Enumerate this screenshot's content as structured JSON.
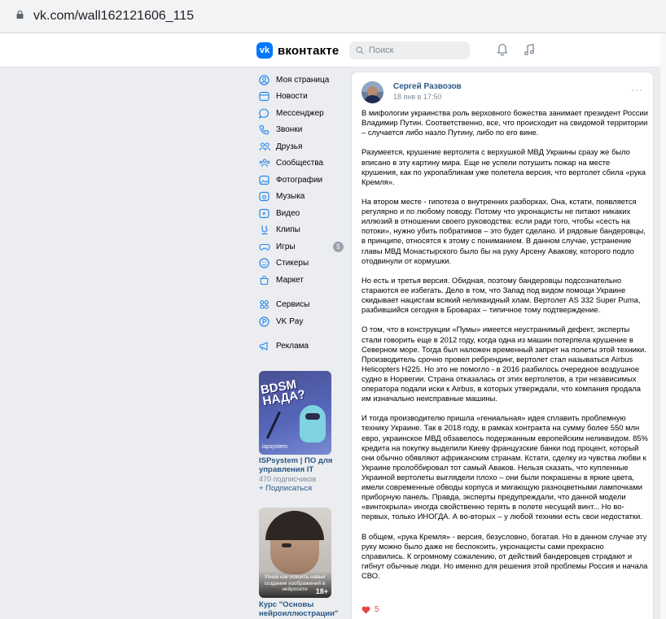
{
  "browser": {
    "url": "vk.com/wall162121606_115"
  },
  "header": {
    "logo_mark": "vk",
    "logo_text": "вконтакте",
    "search_placeholder": "Поиск"
  },
  "sidebar": {
    "items": [
      {
        "label": "Моя страница",
        "icon": "profile-icon"
      },
      {
        "label": "Новости",
        "icon": "news-icon"
      },
      {
        "label": "Мессенджер",
        "icon": "messenger-icon"
      },
      {
        "label": "Звонки",
        "icon": "phone-icon"
      },
      {
        "label": "Друзья",
        "icon": "friends-icon"
      },
      {
        "label": "Сообщества",
        "icon": "communities-icon"
      },
      {
        "label": "Фотографии",
        "icon": "photos-icon"
      },
      {
        "label": "Музыка",
        "icon": "music-icon"
      },
      {
        "label": "Видео",
        "icon": "video-icon"
      },
      {
        "label": "Клипы",
        "icon": "clips-icon"
      },
      {
        "label": "Игры",
        "icon": "games-icon",
        "badge": "5"
      },
      {
        "label": "Стикеры",
        "icon": "stickers-icon"
      },
      {
        "label": "Маркет",
        "icon": "market-icon"
      }
    ],
    "items2": [
      {
        "label": "Сервисы",
        "icon": "services-icon"
      },
      {
        "label": "VK Pay",
        "icon": "vkpay-icon"
      }
    ],
    "ads_label": "Реклама"
  },
  "ads": [
    {
      "image_text": "BDSM НАДА?",
      "brand": "ispsystem",
      "title": "ISPsystem | ПО для управления IT",
      "subscribers": "470 подписчиков",
      "action": "+ Подписаться"
    },
    {
      "image_text": "Узнай как освоить навык создания изображений в нейросети",
      "age": "18+",
      "title": "Курс \"Основы нейроиллюстрации\""
    }
  ],
  "post": {
    "author": "Сергей Развозов",
    "date": "18 янв в 17:50",
    "more": "···",
    "paragraphs": [
      "В мифологии украинства роль верховного божества занимает президент России Владимир Путин. Соответственно, все, что происходит на свидомой территории – случается либо назло Путину, либо по его вине.",
      "Разумеется, крушение вертолета с верхушкой МВД Украины сразу же было вписано в эту картину мира. Еще не успели потушить пожар на месте крушения, как по укропабликам уже полетела версия, что вертолет сбила «рука Кремля».",
      "На втором месте - гипотеза о внутренних разборках. Она, кстати, появляется регулярно и по любому поводу. Потому что укронацисты не питают никаких иллюзий в отношении своего руководства: если ради того, чтобы «сесть на потоки», нужно убить побратимов – это будет сделано. И рядовые бандеровцы, в принципе, относятся к этому с пониманием. В данном случае, устранение главы МВД Монастырского было бы на руку Арсену Авакову, которого подло отодвинули от кормушки.",
      "Но есть и третья версия. Обидная, поэтому бандеровцы подсознательно стараются ее избегать. Дело в том, что Запад под видом помощи Украине скидывает нацистам всякий неликвидный хлам. Вертолет AS 332 Super Puma, разбившийся сегодня в Броварах – типичное тому подтверждение.",
      "О том, что в конструкции «Пумы» имеется неустранимый дефект, эксперты стали говорить еще в 2012 году, когда одна из машин потерпела крушение в Северном море. Тогда был наложен временный запрет на полеты этой техники. Производитель срочно провел ребрендинг, вертолет стал называться Airbus Helicopters H225. Но это не помогло - в 2016 разбилось очередное воздушное судно в Норвегии. Страна отказалась от этих вертолетов, а три независимых оператора подали иски к Airbus, в которых утверждали, что компания продала им изначально неисправные машины.",
      "И тогда производителю пришла «гениальная» идея сплавить проблемную технику Украине. Так в 2018 году, в рамках контракта на сумму более 550 млн евро, украинское МВД обзавелось подержанным европейским неликвидом. 85% кредита на покупку выделили Киеву французские банки под процент, который они обычно обявляют африканским странам. Кстати, сделку из чувства любви к Украине пролоббировал тот самый Аваков. Нельзя сказать, что купленные Украиной вертолеты выглядели плохо – они были покрашены в яркие цвета, имели современные обводы корпуса и мигающую разноцветными лампочками приборную панель. Правда, эксперты предупреждали, что данной модели «винтокрыла» иногда свойственно терять в полете несущий винт... Но во-первых, только ИНОГДА. А во-вторых – у любой техники есть свои недостатки.",
      "В общем, «рука Кремля» - версия, безусловно, богатая. Но в данном случае эту руку можно было даже не беспокоить, укронацисты сами прекрасно справились. К огромному сожалению, от действий бандеровцев страдают и гибнут обычные люди. Но именно для решения этой проблемы Россия и начала СВО."
    ],
    "likes": "5"
  },
  "colors": {
    "accent": "#0077ff",
    "link": "#2a5885",
    "like": "#e64646"
  }
}
